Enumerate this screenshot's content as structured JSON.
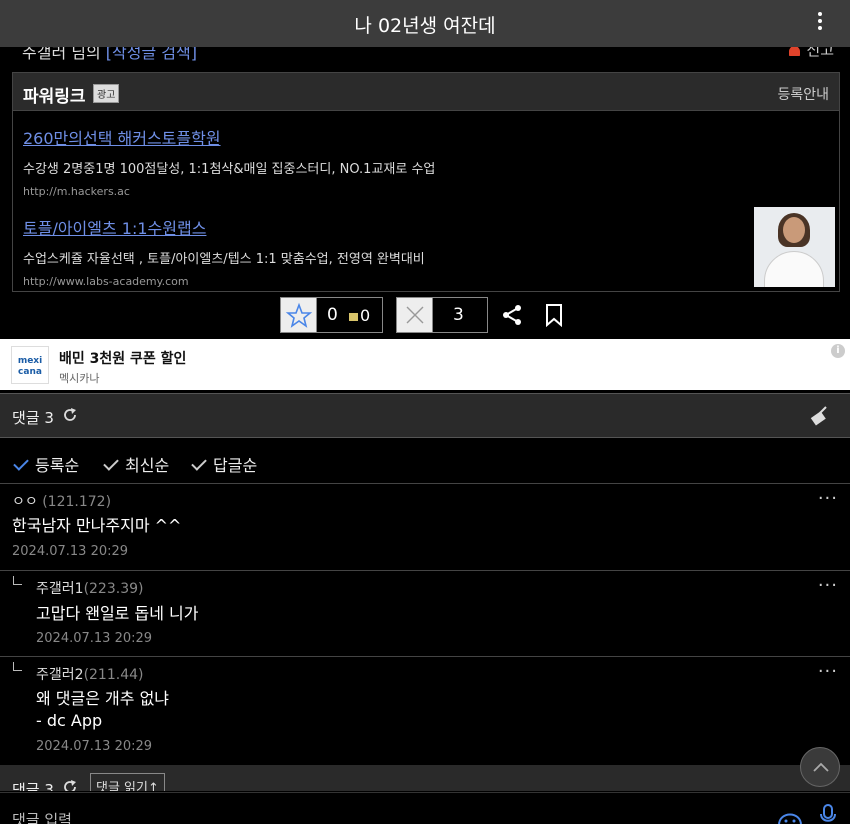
{
  "header": {
    "title": "나 02년생 여잔데"
  },
  "post_meta": {
    "author_label": "주갤러 님의",
    "search_link": "[작성글 검색]",
    "report": "신고"
  },
  "powerlink": {
    "title": "파워링크",
    "ad_badge": "광고",
    "register": "등록안내",
    "ads": [
      {
        "headline": "260만의선택 해커스토플학원",
        "desc": "수강생 2명중1명 100점달성, 1:1첨삭&매일 집중스터디, NO.1교재로 수업",
        "url": "http://m.hackers.ac"
      },
      {
        "headline": "토플/아이엘츠 1:1수원랩스",
        "desc": "수업스케쥴 자율선택 , 토플/아이엘츠/텝스 1:1 맞춤수업, 전영역 완벽대비",
        "url": "http://www.labs-academy.com"
      }
    ]
  },
  "actions": {
    "recommend_count": "0",
    "fixed_count": "0",
    "nonrecommend_count": "3"
  },
  "banner": {
    "logo_text": "mexi cana",
    "title": "배민 3천원 쿠폰 할인",
    "sub": "멕시카나",
    "info": "i"
  },
  "comments_header": {
    "label": "댓글 3",
    "close_label": "댓글 읽기↑"
  },
  "sort_options": [
    "등록순",
    "최신순",
    "답글순"
  ],
  "comments": [
    {
      "nick": "ㅇㅇ",
      "ip": "(121.172)",
      "body": "한국남자 만나주지마 ^^",
      "date": "2024.07.13 20:29"
    },
    {
      "nick": "주갤러1",
      "ip": "(223.39)",
      "body": "고맙다 왠일로 돕네 니가",
      "date": "2024.07.13 20:29"
    },
    {
      "nick": "주갤러2",
      "ip": "(211.44)",
      "body": "왜 댓글은 개추 없냐",
      "body2": "- dc App",
      "date": "2024.07.13 20:29"
    }
  ],
  "more_glyph": "···",
  "input": {
    "placeholder": "댓글 입력"
  },
  "colors": {
    "link": "#6f8fe6",
    "accent": "#4a86e8",
    "topbar": "#3c3c3c"
  }
}
